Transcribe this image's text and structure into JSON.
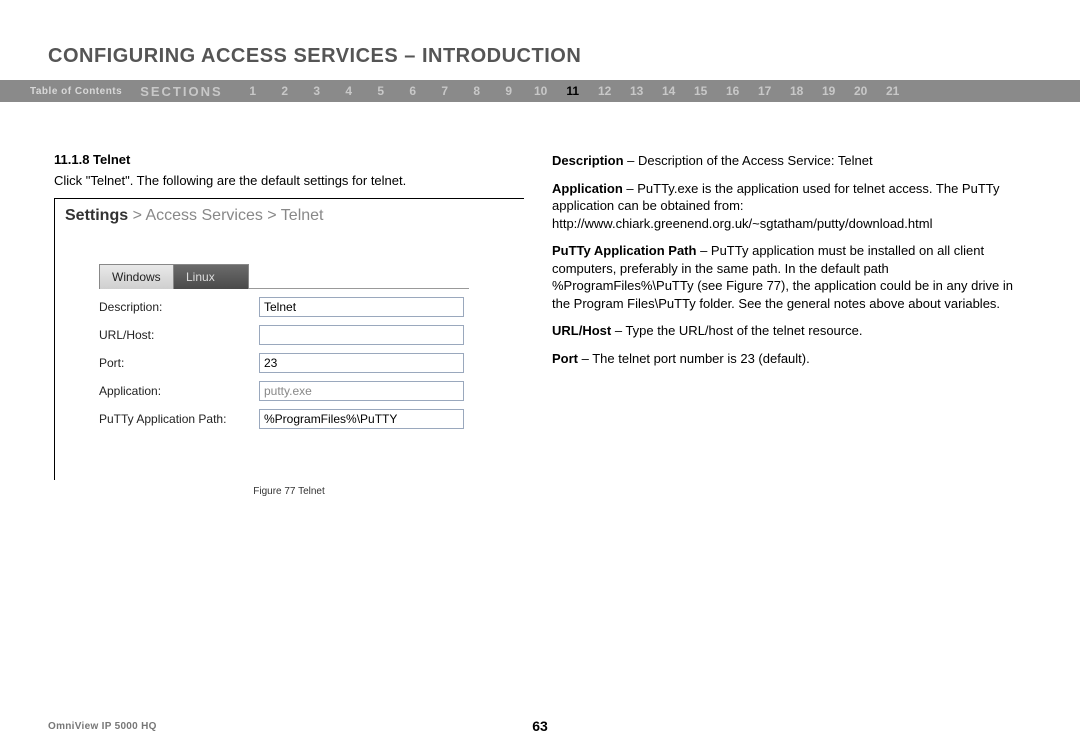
{
  "title": "CONFIGURING ACCESS SERVICES – INTRODUCTION",
  "nav": {
    "toc": "Table of Contents",
    "sections_label": "SECTIONS",
    "numbers": [
      "1",
      "2",
      "3",
      "4",
      "5",
      "6",
      "7",
      "8",
      "9",
      "10",
      "11",
      "12",
      "13",
      "14",
      "15",
      "16",
      "17",
      "18",
      "19",
      "20",
      "21"
    ],
    "active": "11"
  },
  "left": {
    "subhead": "11.1.8 Telnet",
    "intro": "Click \"Telnet\". The following are the default settings for telnet.",
    "breadcrumb": {
      "strong": "Settings",
      "mid": " > Access Services > ",
      "tail": "Telnet"
    },
    "tabs": {
      "windows": "Windows",
      "linux": "Linux"
    },
    "form": {
      "desc_label": "Description:",
      "desc_value": "Telnet",
      "urlhost_label": "URL/Host:",
      "urlhost_value": "",
      "port_label": "Port:",
      "port_value": "23",
      "app_label": "Application:",
      "app_value": "putty.exe",
      "path_label": "PuTTy Application Path:",
      "path_value": "%ProgramFiles%\\PuTTY"
    },
    "caption": "Figure 77 Telnet"
  },
  "right": {
    "desc_label": "Description",
    "desc_text": " – Description of the Access Service: Telnet",
    "app_label": "Application",
    "app_text": " – PuTTy.exe is the application used for telnet access. The PuTTy application can be obtained from: http://www.chiark.greenend.org.uk/~sgtatham/putty/download.html",
    "path_label": "PuTTy Application Path",
    "path_text": " – PuTTy application must be installed on all client computers, preferably in the same path. In the default path %ProgramFiles%\\PuTTy (see Figure 77), the application could be in any drive in the Program Files\\PuTTy folder. See the general notes above about variables.",
    "url_label": "URL/Host",
    "url_text": " – Type the URL/host of the telnet resource.",
    "port_label": "Port",
    "port_text": " – The telnet port number is 23 (default)."
  },
  "footer": {
    "left": "OmniView IP 5000 HQ",
    "page": "63"
  }
}
